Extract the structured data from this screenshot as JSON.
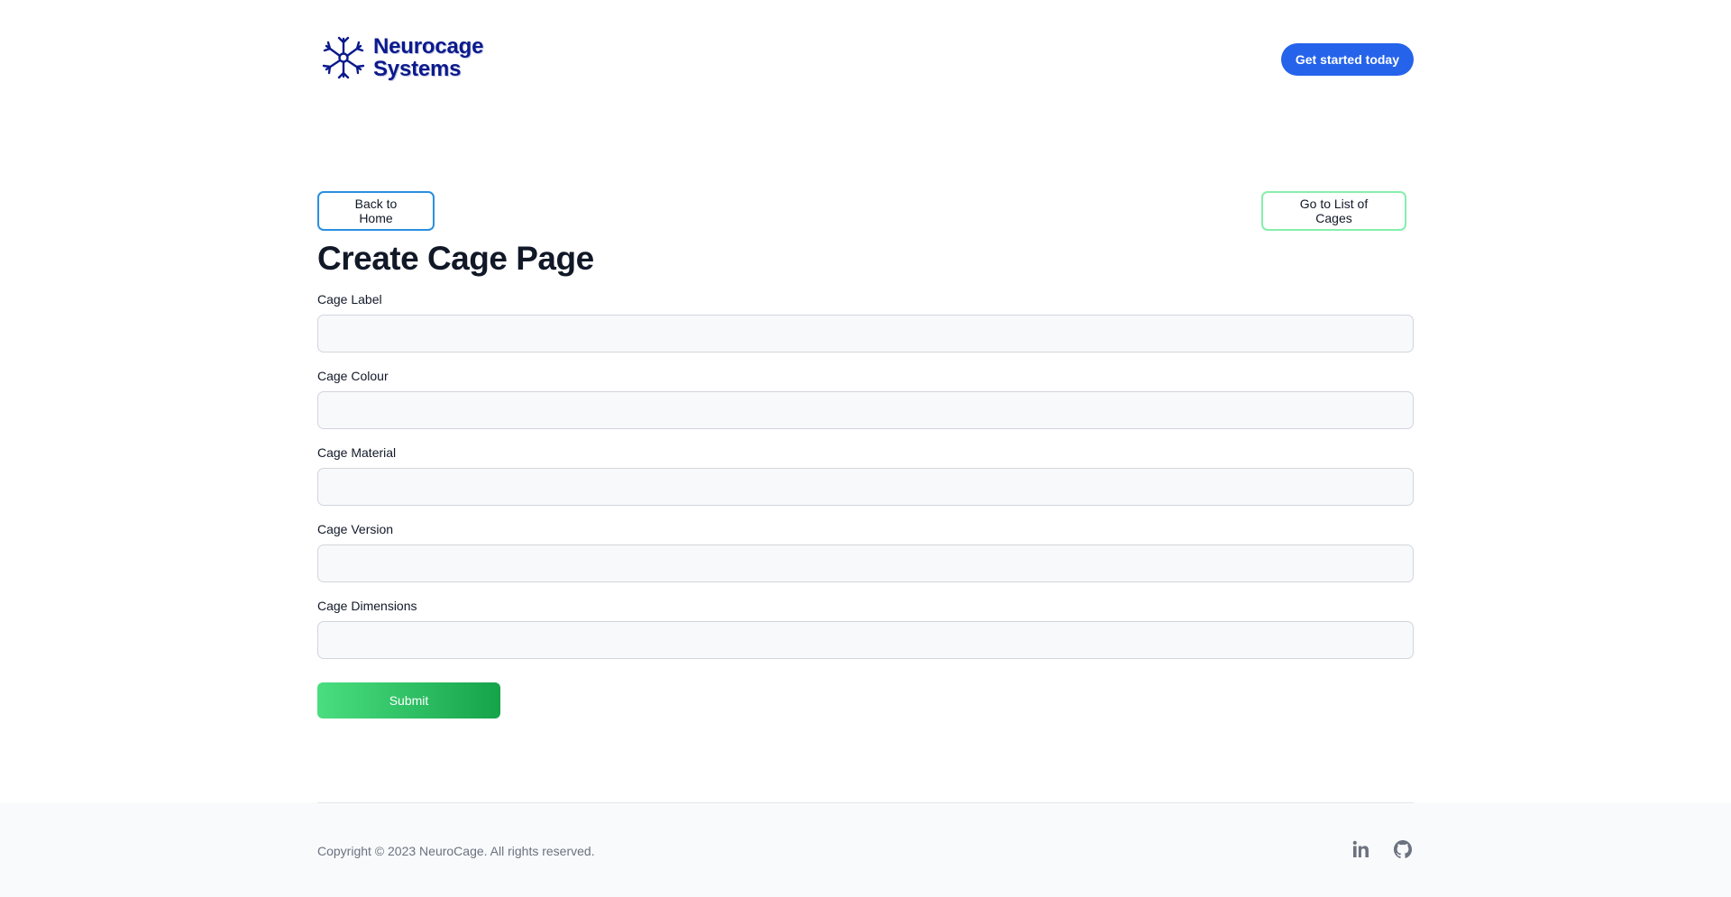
{
  "header": {
    "logo_line1": "Neurocage",
    "logo_line2": "Systems",
    "cta_label": "Get started today"
  },
  "nav": {
    "back_label": "Back to Home",
    "list_label": "Go to List of Cages"
  },
  "page_title": "Create Cage Page",
  "form": {
    "fields": [
      {
        "label": "Cage Label",
        "value": ""
      },
      {
        "label": "Cage Colour",
        "value": ""
      },
      {
        "label": "Cage Material",
        "value": ""
      },
      {
        "label": "Cage Version",
        "value": ""
      },
      {
        "label": "Cage Dimensions",
        "value": ""
      }
    ],
    "submit_label": "Submit"
  },
  "footer": {
    "copyright": "Copyright © 2023 NeuroCage. All rights reserved.",
    "social": [
      "linkedin-icon",
      "github-icon"
    ]
  },
  "colors": {
    "brand": "#0b1a8c",
    "primary": "#2563eb",
    "success_start": "#4ade80",
    "success_end": "#16a34a",
    "back_border": "#2a8fe0",
    "list_border": "#86efac"
  }
}
